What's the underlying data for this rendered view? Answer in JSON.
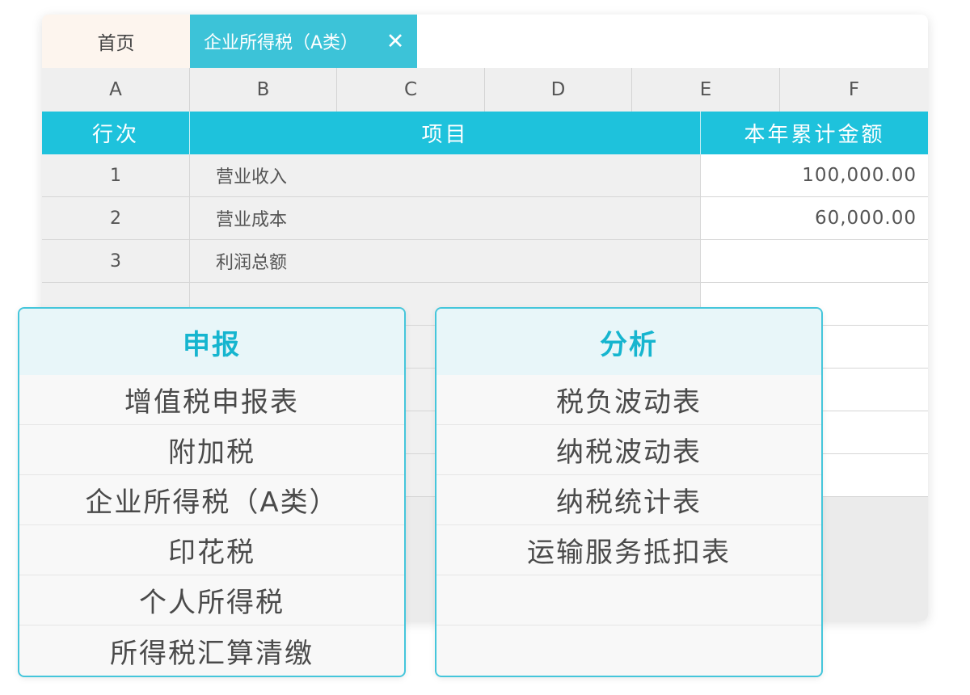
{
  "tabs": {
    "home": "首页",
    "active": "企业所得税（A类）",
    "close_icon": "✕"
  },
  "columns": [
    "A",
    "B",
    "C",
    "D",
    "E",
    "F"
  ],
  "table": {
    "headers": {
      "row_no": "行次",
      "item": "项目",
      "amount": "本年累计金额"
    },
    "rows": [
      {
        "no": "1",
        "item": "营业收入",
        "amount": "100,000.00"
      },
      {
        "no": "2",
        "item": "营业成本",
        "amount": "60,000.00"
      },
      {
        "no": "3",
        "item": "利润总额",
        "amount": ""
      },
      {
        "no": "",
        "item": "",
        "amount": ""
      },
      {
        "no": "",
        "item": "",
        "amount": ""
      },
      {
        "no": "",
        "item": "",
        "amount": ""
      },
      {
        "no": "",
        "item": "",
        "amount": ""
      },
      {
        "no": "",
        "item": "",
        "amount": ""
      }
    ]
  },
  "panels": {
    "declare": {
      "title": "申报",
      "items": [
        "增值税申报表",
        "附加税",
        "企业所得税（A类）",
        "印花税",
        "个人所得税",
        "所得税汇算清缴"
      ]
    },
    "analysis": {
      "title": "分析",
      "items": [
        "税负波动表",
        "纳税波动表",
        "纳税统计表",
        "运输服务抵扣表",
        "",
        ""
      ]
    }
  },
  "colors": {
    "accent": "#1ec2dc",
    "tab_active": "#3cc3d8",
    "panel_border": "#45c6db",
    "panel_title": "#16b5cf"
  }
}
